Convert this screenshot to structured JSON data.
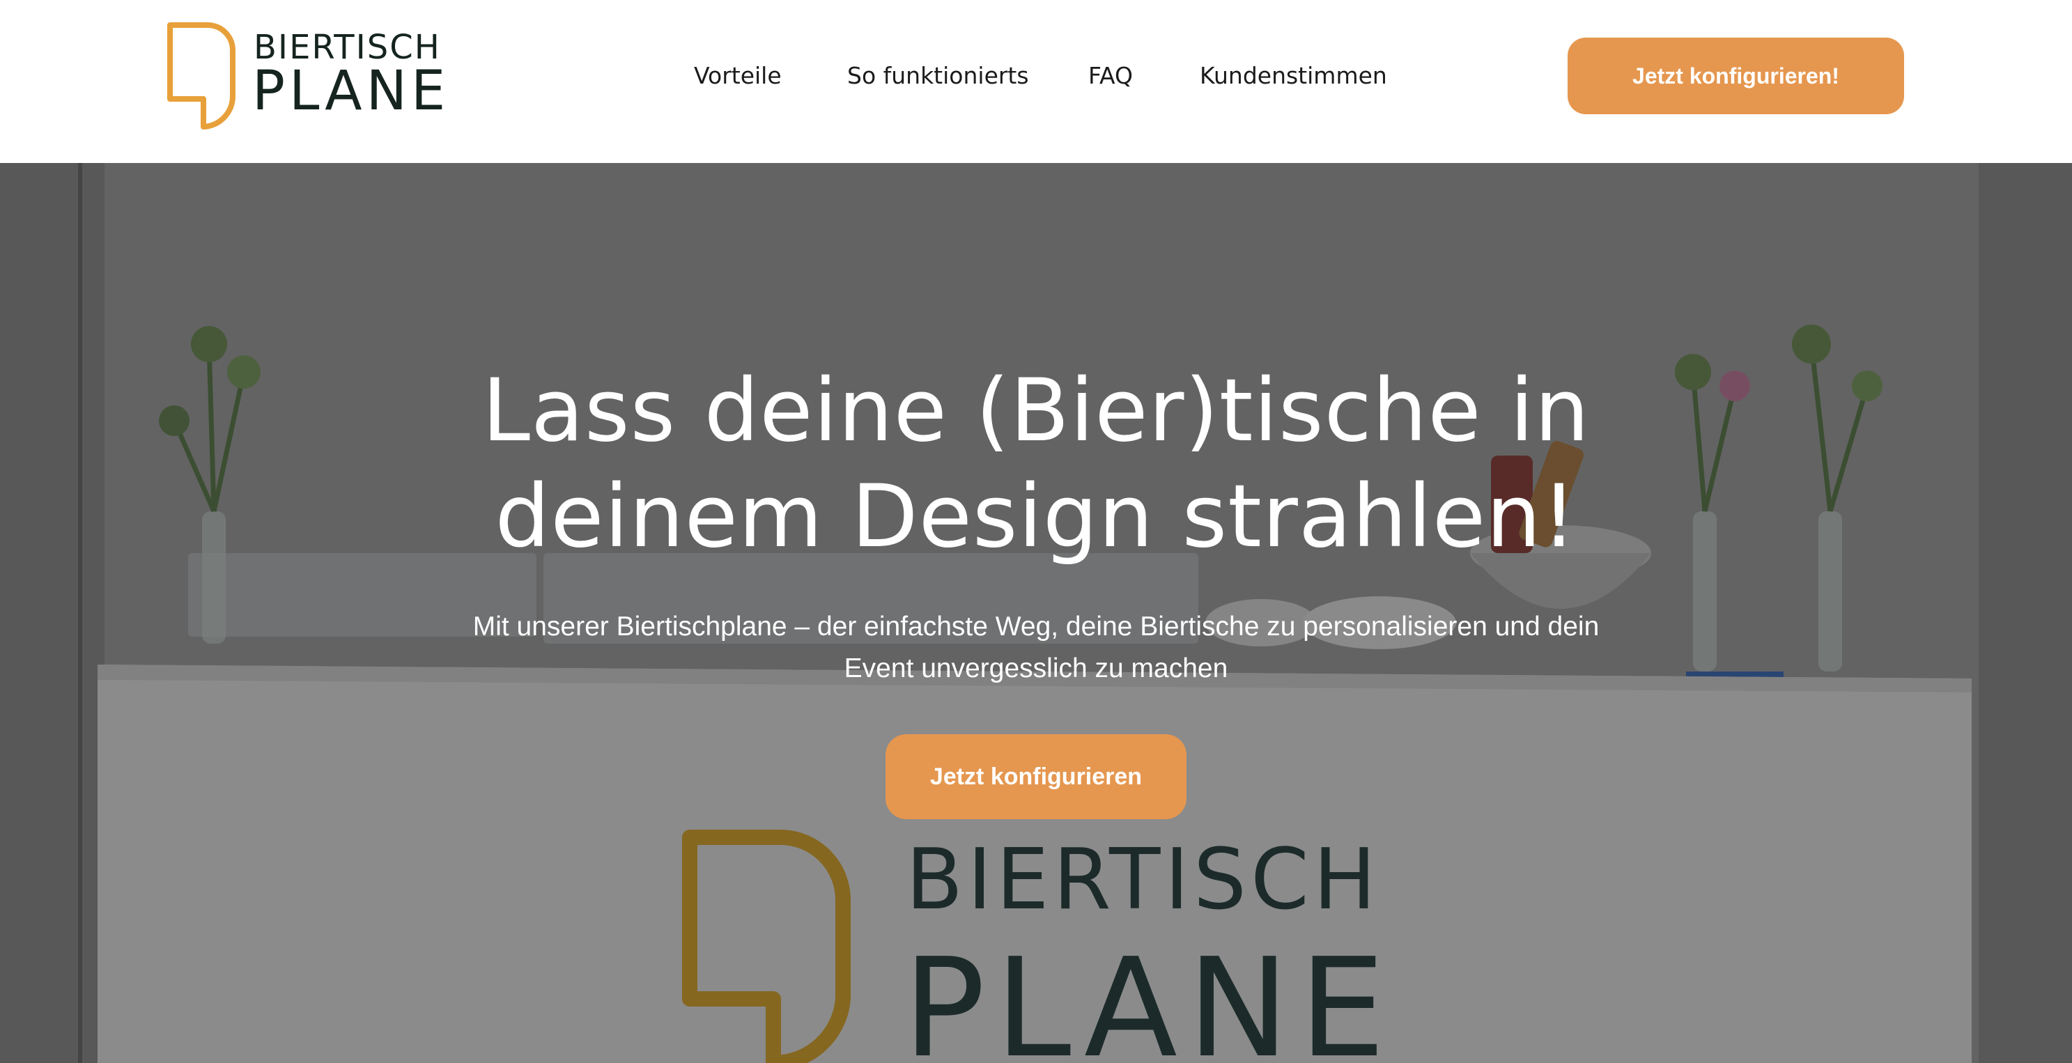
{
  "header": {
    "logo": {
      "line1": "BIERTISCH",
      "line2": "PLANE"
    },
    "nav": [
      {
        "label": "Vorteile"
      },
      {
        "label": "So funktionierts"
      },
      {
        "label": "FAQ"
      },
      {
        "label": "Kundenstimmen"
      }
    ],
    "cta_label": "Jetzt konfigurieren!"
  },
  "hero": {
    "title": "Lass deine (Bier)tische in deinem Design strahlen!",
    "subtitle": "Mit unserer Biertischplane – der einfachste Weg, deine Biertische zu personalisieren und dein Event unvergesslich zu machen",
    "cta_label": "Jetzt konfigurieren",
    "banner_logo": {
      "line1": "BIERTISCH",
      "line2": "PLANE"
    }
  },
  "colors": {
    "accent": "#e5974f",
    "logo_orange": "#e8a03a",
    "text_dark": "#15241f",
    "overlay": "#282828"
  },
  "icons": {
    "logo_mark": "biertisch-plane-logo-icon"
  }
}
